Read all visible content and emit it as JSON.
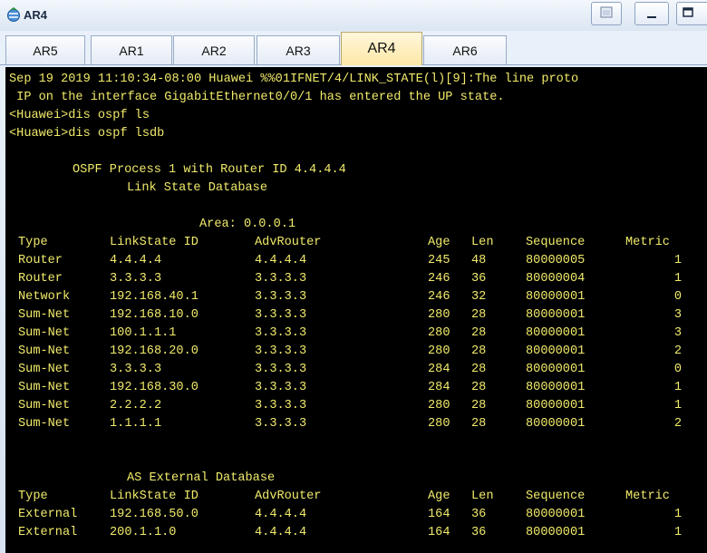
{
  "window": {
    "title": "AR4",
    "icon": "router-network-icon"
  },
  "tabs": [
    {
      "label": "AR5",
      "active": false
    },
    {
      "label": "AR1",
      "active": false
    },
    {
      "label": "AR2",
      "active": false
    },
    {
      "label": "AR3",
      "active": false
    },
    {
      "label": "AR4",
      "active": true
    },
    {
      "label": "AR6",
      "active": false
    }
  ],
  "terminal": {
    "text_color": "#f0ea6a",
    "background": "#000000",
    "log_lines": [
      "Sep 19 2019 11:10:34-08:00 Huawei %%01IFNET/4/LINK_STATE(l)[9]:The line proto",
      " IP on the interface GigabitEthernet0/0/1 has entered the UP state.",
      "<Huawei>dis ospf ls",
      "<Huawei>dis ospf lsdb"
    ],
    "process_header": "OSPF Process 1 with Router ID 4.4.4.4",
    "db_title": "Link State Database",
    "area_label": "Area: 0.0.0.1",
    "columns": [
      "Type",
      "LinkState ID",
      "AdvRouter",
      "Age",
      "Len",
      "Sequence",
      "Metric"
    ],
    "area_rows": [
      [
        "Router",
        "4.4.4.4",
        "4.4.4.4",
        "245",
        "48",
        "80000005",
        "1"
      ],
      [
        "Router",
        "3.3.3.3",
        "3.3.3.3",
        "246",
        "36",
        "80000004",
        "1"
      ],
      [
        "Network",
        "192.168.40.1",
        "3.3.3.3",
        "246",
        "32",
        "80000001",
        "0"
      ],
      [
        "Sum-Net",
        "192.168.10.0",
        "3.3.3.3",
        "280",
        "28",
        "80000001",
        "3"
      ],
      [
        "Sum-Net",
        "100.1.1.1",
        "3.3.3.3",
        "280",
        "28",
        "80000001",
        "3"
      ],
      [
        "Sum-Net",
        "192.168.20.0",
        "3.3.3.3",
        "280",
        "28",
        "80000001",
        "2"
      ],
      [
        "Sum-Net",
        "3.3.3.3",
        "3.3.3.3",
        "284",
        "28",
        "80000001",
        "0"
      ],
      [
        "Sum-Net",
        "192.168.30.0",
        "3.3.3.3",
        "284",
        "28",
        "80000001",
        "1"
      ],
      [
        "Sum-Net",
        "2.2.2.2",
        "3.3.3.3",
        "280",
        "28",
        "80000001",
        "1"
      ],
      [
        "Sum-Net",
        "1.1.1.1",
        "3.3.3.3",
        "280",
        "28",
        "80000001",
        "2"
      ]
    ],
    "external_title": "AS External Database",
    "external_rows": [
      [
        "External",
        "192.168.50.0",
        "4.4.4.4",
        "164",
        "36",
        "80000001",
        "1"
      ],
      [
        "External",
        "200.1.1.0",
        "4.4.4.4",
        "164",
        "36",
        "80000001",
        "1"
      ]
    ]
  }
}
